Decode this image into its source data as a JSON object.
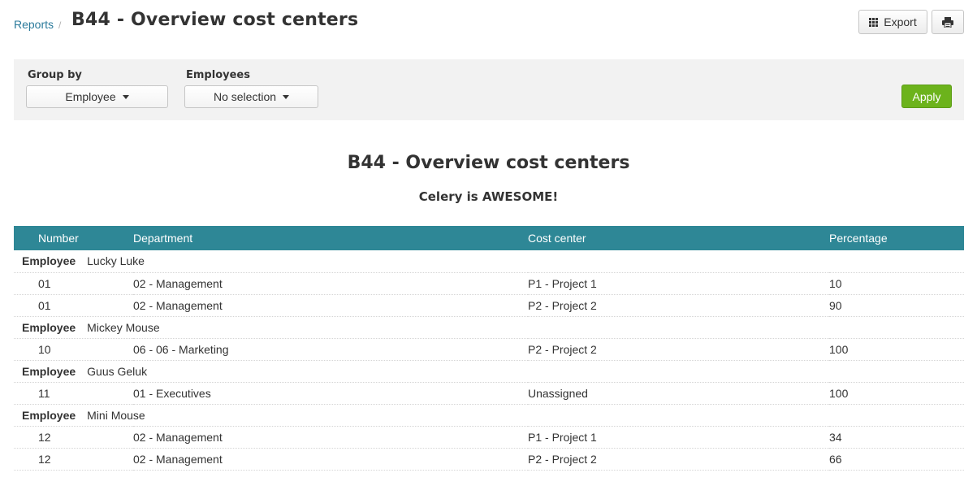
{
  "header": {
    "breadcrumb_link": "Reports",
    "breadcrumb_sep": "/",
    "title": "B44 - Overview cost centers",
    "export_label": "Export"
  },
  "filters": {
    "group_by_label": "Group by",
    "group_by_value": "Employee",
    "employees_label": "Employees",
    "employees_value": "No selection",
    "apply_label": "Apply"
  },
  "report": {
    "title": "B44 - Overview cost centers",
    "subtitle": "Celery is AWESOME!",
    "columns": [
      "Number",
      "Department",
      "Cost center",
      "Percentage"
    ],
    "group_key": "Employee",
    "groups": [
      {
        "name": "Lucky Luke",
        "rows": [
          [
            "01",
            "02 - Management",
            "P1 - Project 1",
            "10"
          ],
          [
            "01",
            "02 - Management",
            "P2 - Project 2",
            "90"
          ]
        ]
      },
      {
        "name": "Mickey Mouse",
        "rows": [
          [
            "10",
            "06 - 06 - Marketing",
            "P2 - Project 2",
            "100"
          ]
        ]
      },
      {
        "name": "Guus Geluk",
        "rows": [
          [
            "11",
            "01 - Executives",
            "Unassigned",
            "100"
          ]
        ]
      },
      {
        "name": "Mini Mouse",
        "rows": [
          [
            "12",
            "02 - Management",
            "P1 - Project 1",
            "34"
          ],
          [
            "12",
            "02 - Management",
            "P2 - Project 2",
            "66"
          ]
        ]
      }
    ]
  },
  "colors": {
    "table_header": "#2e8796",
    "apply_button": "#6cb31c",
    "link": "#2a7a9b"
  }
}
